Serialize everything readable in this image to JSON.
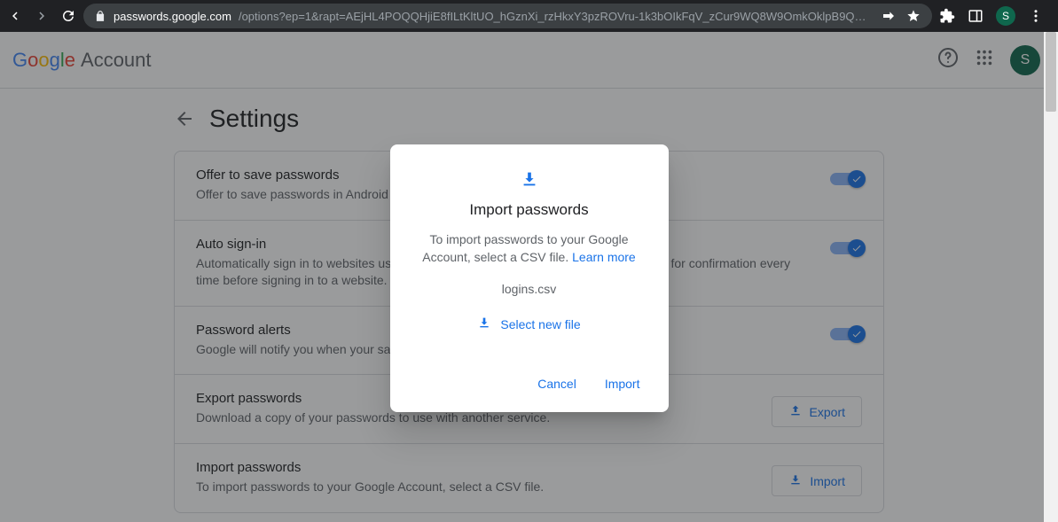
{
  "browser": {
    "url_host": "passwords.google.com",
    "url_path": "/options?ep=1&rapt=AEjHL4POQQHjiE8fILtKltUO_hGznXi_rzHkxY3pzROVru-1k3bOIkFqV_zCur9WQ8W9OmkOklpB9QRz...",
    "avatar_initial": "S"
  },
  "header": {
    "logo_letters": [
      "G",
      "o",
      "o",
      "g",
      "l",
      "e"
    ],
    "account_word": "Account",
    "avatar_initial": "S"
  },
  "page": {
    "title": "Settings"
  },
  "settings": [
    {
      "title": "Offer to save passwords",
      "desc": "Offer to save passwords in Android and Chrome",
      "control": "toggle",
      "on": true
    },
    {
      "title": "Auto sign-in",
      "desc": "Automatically sign in to websites using stored credentials. If turned off, you'll be asked for confirmation every time before signing in to a website.",
      "control": "toggle",
      "on": true
    },
    {
      "title": "Password alerts",
      "desc": "Google will notify you when your saved passwords are found online.",
      "control": "toggle",
      "on": true
    },
    {
      "title": "Export passwords",
      "desc": "Download a copy of your passwords to use with another service.",
      "control": "button",
      "button_label": "Export",
      "button_icon": "upload"
    },
    {
      "title": "Import passwords",
      "desc": "To import passwords to your Google Account, select a CSV file.",
      "control": "button",
      "button_label": "Import",
      "button_icon": "download"
    }
  ],
  "dialog": {
    "title": "Import passwords",
    "body_prefix": "To import passwords to your Google Account, select a CSV file. ",
    "learn_more": "Learn more",
    "filename": "logins.csv",
    "select_new": "Select new file",
    "cancel": "Cancel",
    "confirm": "Import"
  },
  "colors": {
    "accent": "#1a73e8",
    "text_secondary": "#5f6368",
    "avatar_bg": "#0f674d"
  }
}
